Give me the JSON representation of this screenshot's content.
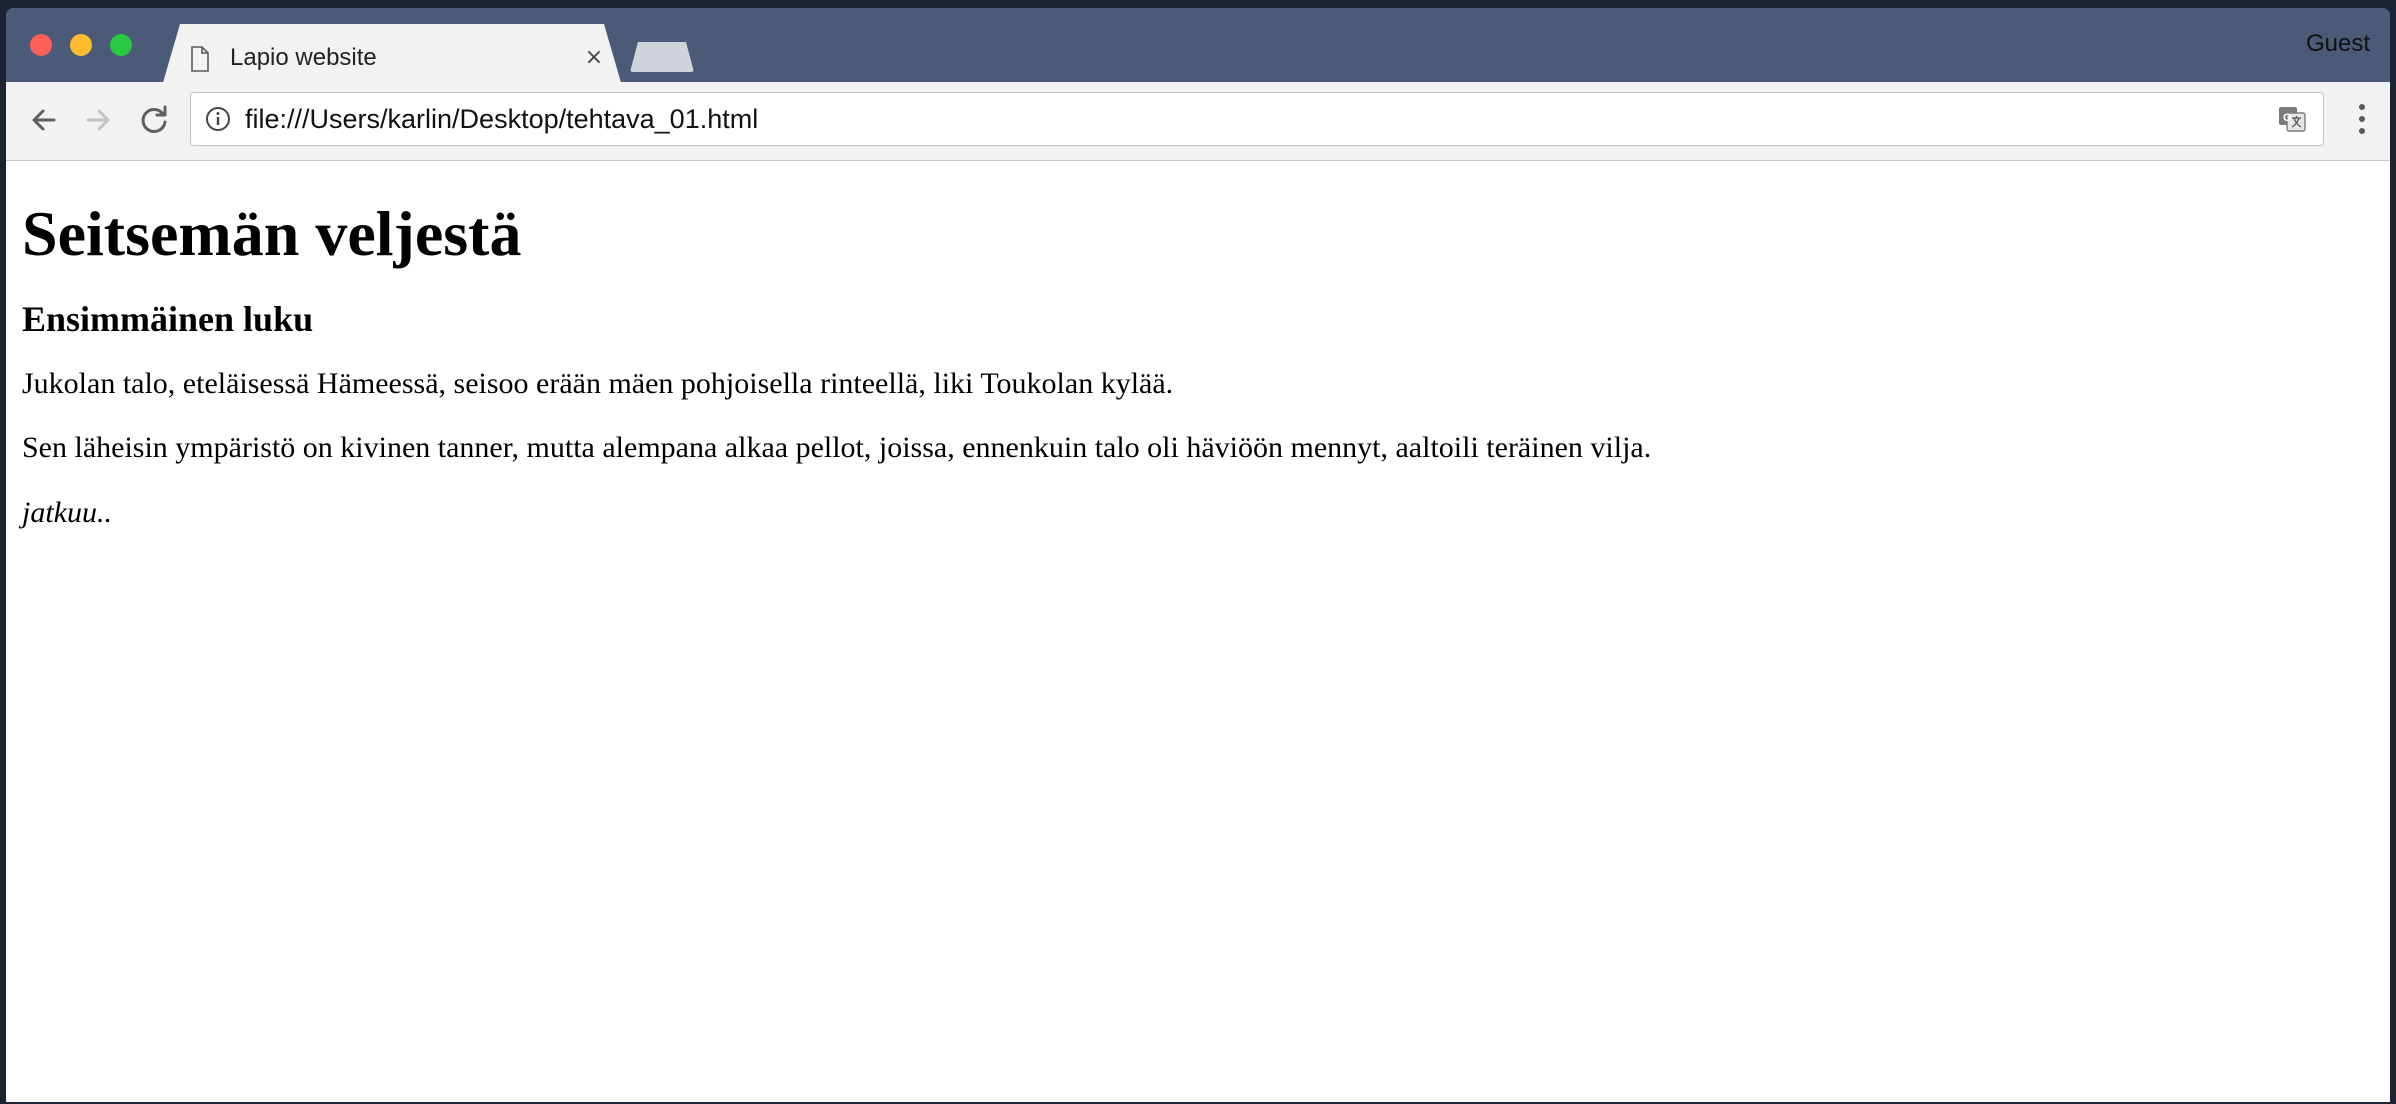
{
  "browser": {
    "tab": {
      "title": "Lapio website",
      "close_glyph": "×",
      "icon": "document-icon"
    },
    "profile_label": "Guest",
    "address_bar": {
      "url": "file:///Users/karlin/Desktop/tehtava_01.html",
      "info_icon": "info-icon",
      "translate_icon": "translate-icon"
    },
    "nav": {
      "back_icon": "arrow-left-icon",
      "forward_icon": "arrow-right-icon",
      "reload_icon": "reload-icon",
      "menu_icon": "kebab-menu-icon"
    },
    "colors": {
      "titlebar": "#4a5a77",
      "tab": "#f2f2f2",
      "toolbar": "#f2f2f2"
    }
  },
  "page": {
    "heading": "Seitsemän veljestä",
    "subheading": "Ensimmäinen luku",
    "paragraphs": [
      "Jukolan talo, eteläisessä Hämeessä, seisoo erään mäen pohjoisella rinteellä, liki Toukolan kylää.",
      "Sen läheisin ympäristö on kivinen tanner, mutta alempana alkaa pellot, joissa, ennenkuin talo oli häviöön mennyt, aaltoili teräinen vilja."
    ],
    "continuation": "jatkuu.."
  }
}
